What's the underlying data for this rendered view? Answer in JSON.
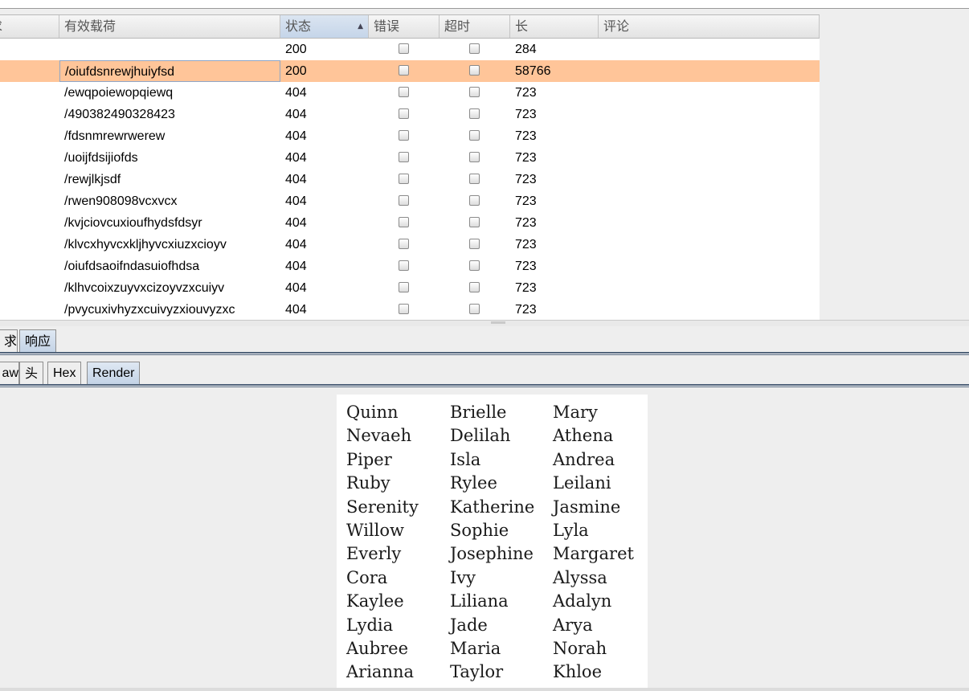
{
  "table": {
    "columns": [
      {
        "key": "req",
        "label": "求"
      },
      {
        "key": "payload",
        "label": "有效载荷"
      },
      {
        "key": "status",
        "label": "状态",
        "sorted": "ascending"
      },
      {
        "key": "error",
        "label": "错误"
      },
      {
        "key": "timeout",
        "label": "超时"
      },
      {
        "key": "length",
        "label": "长"
      },
      {
        "key": "comment",
        "label": "评论"
      }
    ],
    "rows": [
      {
        "payload": "",
        "status": "200",
        "error": false,
        "timeout": false,
        "length": "284",
        "comment": ""
      },
      {
        "payload": "/oiufdsnrewjhuiyfsd",
        "status": "200",
        "error": false,
        "timeout": false,
        "length": "58766",
        "comment": "",
        "selected": true
      },
      {
        "payload": "/ewqpoiewopqiewq",
        "status": "404",
        "error": false,
        "timeout": false,
        "length": "723",
        "comment": ""
      },
      {
        "payload": "/490382490328423",
        "status": "404",
        "error": false,
        "timeout": false,
        "length": "723",
        "comment": ""
      },
      {
        "payload": "/fdsnmrewrwerew",
        "status": "404",
        "error": false,
        "timeout": false,
        "length": "723",
        "comment": ""
      },
      {
        "payload": "/uoijfdsijiofds",
        "status": "404",
        "error": false,
        "timeout": false,
        "length": "723",
        "comment": ""
      },
      {
        "payload": "/rewjlkjsdf",
        "status": "404",
        "error": false,
        "timeout": false,
        "length": "723",
        "comment": ""
      },
      {
        "payload": "/rwen908098vcxvcx",
        "status": "404",
        "error": false,
        "timeout": false,
        "length": "723",
        "comment": ""
      },
      {
        "payload": "/kvjciovcuxioufhydsfdsyr",
        "status": "404",
        "error": false,
        "timeout": false,
        "length": "723",
        "comment": ""
      },
      {
        "payload": "/klvcxhyvcxkljhyvcxiuzxcioyv",
        "status": "404",
        "error": false,
        "timeout": false,
        "length": "723",
        "comment": ""
      },
      {
        "payload": "/oiufdsaoifndasuiofhdsa",
        "status": "404",
        "error": false,
        "timeout": false,
        "length": "723",
        "comment": ""
      },
      {
        "payload": "/klhvcoixzuyvxcizoyvzxcuiyv",
        "status": "404",
        "error": false,
        "timeout": false,
        "length": "723",
        "comment": ""
      },
      {
        "payload": "/pvycuxivhyzxcuivyzxiouvyzxc",
        "status": "404",
        "error": false,
        "timeout": false,
        "length": "723",
        "comment": ""
      }
    ]
  },
  "message_tabs": [
    {
      "label": "求",
      "active": false
    },
    {
      "label": "响应",
      "active": true
    }
  ],
  "view_tabs": [
    {
      "label": "aw",
      "active": false
    },
    {
      "label": "头",
      "active": false
    },
    {
      "label": "Hex",
      "active": false
    },
    {
      "label": "Render",
      "active": true
    }
  ],
  "render": {
    "columns": [
      [
        "Quinn",
        "Nevaeh",
        "Piper",
        "Ruby",
        "Serenity",
        "Willow",
        "Everly",
        "Cora",
        "Kaylee",
        "Lydia",
        "Aubree",
        "Arianna"
      ],
      [
        "Brielle",
        "Delilah",
        "Isla",
        "Rylee",
        "Katherine",
        "Sophie",
        "Josephine",
        "Ivy",
        "Liliana",
        "Jade",
        "Maria",
        "Taylor"
      ],
      [
        "Mary",
        "Athena",
        "Andrea",
        "Leilani",
        "Jasmine",
        "Lyla",
        "Margaret",
        "Alyssa",
        "Adalyn",
        "Arya",
        "Norah",
        "Khloe"
      ]
    ]
  },
  "colors": {
    "selected_row": "#ffc599",
    "sorted_header": "#c5d5e9",
    "tab_active": "#c4d3e6",
    "tab_border": "#51637a"
  }
}
